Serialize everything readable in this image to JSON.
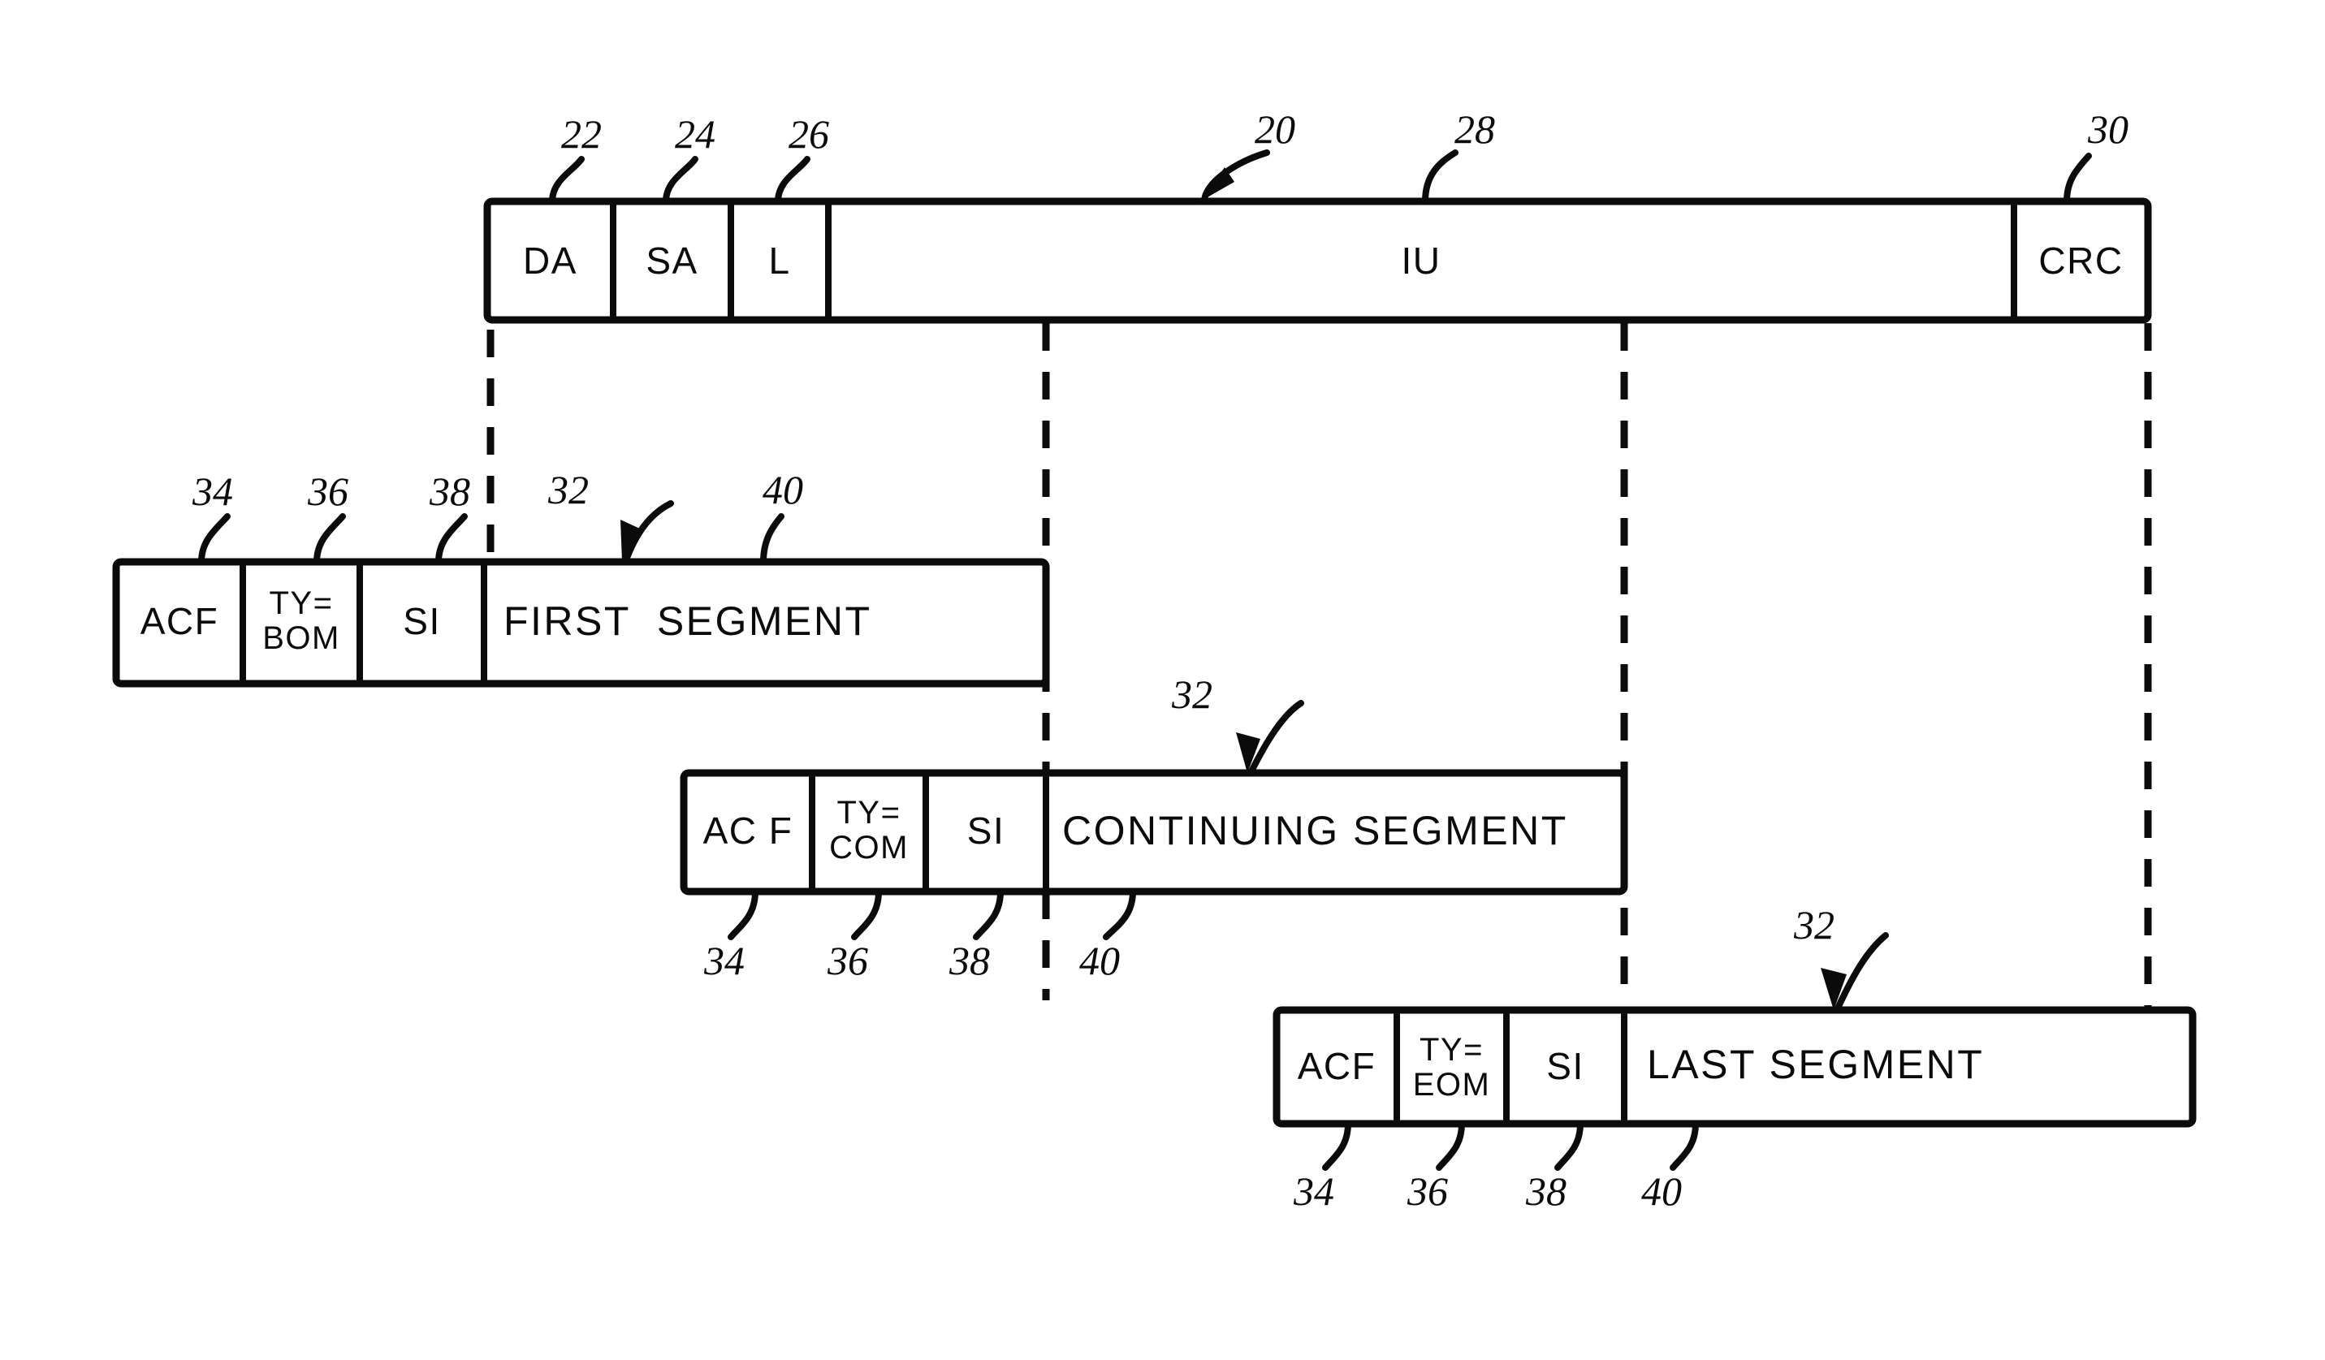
{
  "figure": {
    "title": "Frame segmentation diagram",
    "ink_color": "#0b0b0b",
    "background_color": "#ffffff"
  },
  "frame": {
    "name": "transmission-frame",
    "cells": [
      {
        "id": "da",
        "label": "DA",
        "ref": "22"
      },
      {
        "id": "sa",
        "label": "SA",
        "ref": "24"
      },
      {
        "id": "l",
        "label": "L",
        "ref": "26"
      },
      {
        "id": "iu",
        "label": "IU",
        "ref": "20"
      },
      {
        "id": "crc",
        "label": "CRC",
        "ref": "30"
      }
    ],
    "iu_end_ref": "28"
  },
  "segments": [
    {
      "id": "first-segment",
      "cells": [
        {
          "id": "acf",
          "label": "ACF",
          "ref": "34"
        },
        {
          "id": "ty",
          "label": "TY=\nBOM",
          "line1": "TY=",
          "line2": "BOM",
          "ref": "36"
        },
        {
          "id": "si",
          "label": "SI",
          "ref": "38"
        },
        {
          "id": "data",
          "label": "FIRST  SEGMENT",
          "ref": "40"
        }
      ],
      "segment_ref": "32",
      "refs_position": "above"
    },
    {
      "id": "continuing-segment",
      "cells": [
        {
          "id": "acf",
          "label": "AC F",
          "ref": "34"
        },
        {
          "id": "ty",
          "label": "TY=\nCOM",
          "line1": "TY=",
          "line2": "COM",
          "ref": "36"
        },
        {
          "id": "si",
          "label": "SI",
          "ref": "38"
        },
        {
          "id": "data",
          "label": "CONTINUING SEGMENT",
          "ref": "40"
        }
      ],
      "segment_ref": "32",
      "refs_position": "below"
    },
    {
      "id": "last-segment",
      "cells": [
        {
          "id": "acf",
          "label": "ACF",
          "ref": "34"
        },
        {
          "id": "ty",
          "label": "TY=\nEOM",
          "line1": "TY=",
          "line2": "EOM",
          "ref": "36"
        },
        {
          "id": "si",
          "label": "SI",
          "ref": "38"
        },
        {
          "id": "data",
          "label": "LAST SEGMENT",
          "ref": "40"
        }
      ],
      "segment_ref": "32",
      "refs_position": "below"
    }
  ]
}
